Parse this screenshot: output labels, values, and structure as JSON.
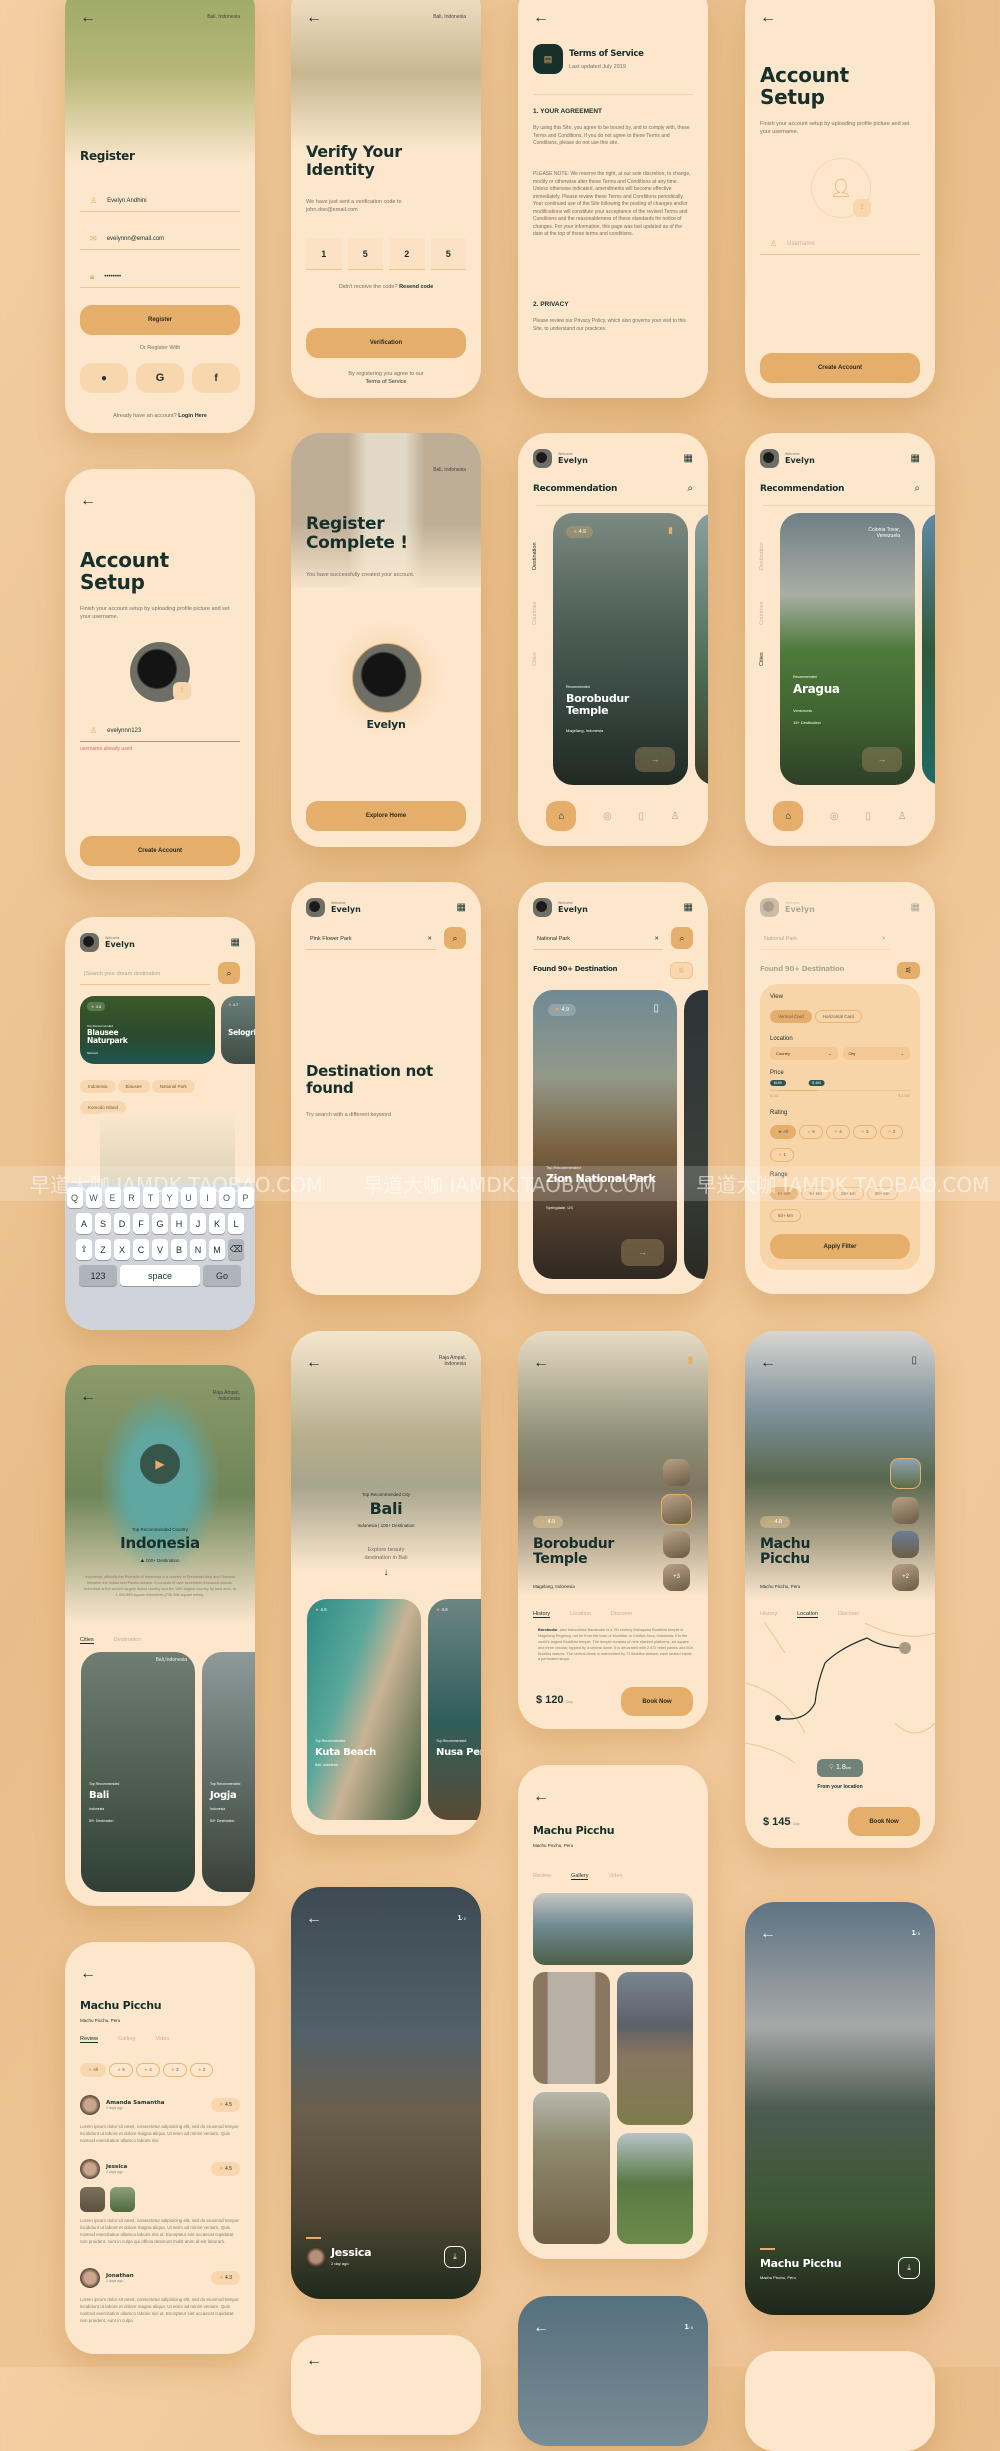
{
  "colors": {
    "background": "#eec395",
    "card": "#fce7cd",
    "accent": "#e6ae6b",
    "dark": "#17302c",
    "error": "#e06a6a"
  },
  "common": {
    "welcome": "Welcome",
    "user": "Evelyn",
    "back_icon": "arrow-left-icon",
    "recommendation": "Recommendation",
    "create_account": "Create Account",
    "book_now": "Book Now",
    "per_day": "/ Day"
  },
  "register": {
    "location": "Bali, Indonesia",
    "title": "Register",
    "name": "Evelyn Andhini",
    "email": "evelynnn@email.com",
    "password": "••••••••",
    "button": "Register",
    "or": "Or Register With",
    "social": [
      "apple",
      "google",
      "facebook"
    ],
    "footer": "Already have an account?",
    "login": "Login Here"
  },
  "verify": {
    "location": "Bali, Indonesia",
    "title": "Verify Your Identity",
    "desc": "We have just sent a verification code to john.doe@email.com",
    "code": [
      "1",
      "5",
      "2",
      "5"
    ],
    "resend_q": "Didn't receive the code?",
    "resend": "Resend code",
    "button": "Verification",
    "terms1": "By registering you agree to  our",
    "terms2": "Terms of Service"
  },
  "terms": {
    "title": "Terms of Service",
    "updated": "Last updated July 2019",
    "h1": "1. YOUR AGREEMENT",
    "p1": "By using this Site, you agree to be bound by, and to comply with, these Terms and Conditions. If you do not agree to these Terms and Conditions, please do not use this site.",
    "p2": "PLEASE NOTE: We reserve the right, at our sole discretion, to change, modify or otherwise alter these Terms and Conditions at any time. Unless otherwise indicated, amendments will become effective immediately. Please review these Terms and Conditions periodically. Your continued use of the Site following the posting of changes and/or modifications will constitute your acceptance of the revised Terms and Conditions and the reasonableness of these standards for notice of changes. For your information, this page was last updated as of the date at the top of these terms and conditions.",
    "h2": "2. PRIVACY",
    "p3": "Please review our Privacy Policy, which also governs your visit to this Site, to understand our practices."
  },
  "setup": {
    "title": "Account Setup",
    "desc": "Finish your account setup by uploading profile picture and set your username.",
    "placeholder": "Username",
    "username": "evelynnn123",
    "error": "username already used"
  },
  "complete": {
    "location": "Bali, Indonesia",
    "title": "Register Complete !",
    "desc": "You have successfully created your account.",
    "name": "Evelyn",
    "button": "Explore Home"
  },
  "reco1": {
    "tabs": [
      "Destination",
      "Countries",
      "Cities"
    ],
    "rating": "4.9",
    "label": "Recommended",
    "name": "Borobudur Temple",
    "place": "Magelang, Indonesia"
  },
  "reco2": {
    "location": "Colonia Tovar, Venezuela",
    "label": "Recommended",
    "name": "Aragua",
    "country": "Venezuela",
    "dest": "15+ Destination"
  },
  "search": {
    "placeholder": "|Search your dream destination",
    "cards": [
      {
        "rating": "4.8",
        "label": "Top Recommended",
        "name": "Blausee Naturpark",
        "place": "Schweiz"
      },
      {
        "rating": "4.7",
        "label": "Top Recommended",
        "name": "Selogriyo Temple"
      }
    ],
    "chips": [
      "Indonesia",
      "Blausee",
      "National Park",
      "Komodo Island"
    ],
    "keyboard": [
      [
        "Q",
        "W",
        "E",
        "R",
        "T",
        "Y",
        "U",
        "I",
        "O",
        "P"
      ],
      [
        "A",
        "S",
        "D",
        "F",
        "G",
        "H",
        "J",
        "K",
        "L"
      ],
      [
        "⇧",
        "Z",
        "X",
        "C",
        "V",
        "B",
        "N",
        "M",
        "⌫"
      ],
      [
        "123",
        "space",
        "Go"
      ]
    ]
  },
  "notfound": {
    "query": "Pink Flower Park",
    "title": "Destination not found",
    "desc": "Try search with a different keyword"
  },
  "results": {
    "query": "National Park",
    "found": "Found 90+ Destination",
    "rating": "4.9",
    "label": "Top Recommended",
    "name": "Zion National Park",
    "place": "Springdale, US"
  },
  "filter": {
    "view": "View",
    "view_opts": [
      "Vertical Card",
      "Horizontal Card"
    ],
    "location": "Location",
    "country": "Country",
    "city": "City",
    "price": "Price",
    "price_low": "$150",
    "price_high": "$ 400",
    "price_min": "$ 100",
    "price_max": "$ 1.000",
    "price_range": [
      150,
      400
    ],
    "price_bounds": [
      100,
      1000
    ],
    "rating": "Rating",
    "rating_opts": [
      "All",
      "5",
      "4",
      "3",
      "2",
      "1"
    ],
    "range": "Range",
    "range_opts": [
      "0+ km",
      "5+ km",
      "15+ km",
      "30+ km",
      "50+ km"
    ],
    "apply": "Apply Filter"
  },
  "indonesia": {
    "location": "Raja Ampat, Indonesia",
    "label": "Top Recommended Country",
    "name": "Indonesia",
    "dest": "100+ Destination",
    "desc": "Indonesia, officially the Republic of Indonesia is a country in Southeast Asia and Oceania between the Indian and Pacific oceans. It consists of over seventeen thousand islands. Indonesia is the world's largest island country and the 14th-largest country by land area, at 1.904.569 square kilometres (735.358 square miles).",
    "tabs": [
      "Cities",
      "Destination"
    ],
    "cards": [
      {
        "location": "Bali,Indonesia",
        "label": "Top Recommended",
        "name": "Bali",
        "country": "Indonesia",
        "dest": "80+ Destination"
      },
      {
        "label": "Top Recommended",
        "name": "Jogja",
        "country": "Indonesia",
        "dest": "50+ Destination"
      }
    ]
  },
  "bali": {
    "location": "Raja Ampat, Indonesia",
    "label": "Top Recommended City",
    "name": "Bali",
    "country": "Indonesia",
    "dest": "100+ Destination",
    "explore": "Explore beauty destination in Bali",
    "cards": [
      {
        "rating": "4.9",
        "label": "Top Recommended",
        "name": "Kuta Beach",
        "place": "Bali, Indonesia"
      },
      {
        "rating": "4.9",
        "label": "Top Recommended",
        "name": "Nusa Penida",
        "place": "Bali, Indonesia"
      }
    ]
  },
  "borobudur": {
    "rating": "4.9",
    "name": "Borobudur Temple",
    "place": "Magelang, Indonesia",
    "more": "+3",
    "tabs": [
      "History",
      "Location",
      "Discover"
    ],
    "lead": "Borobudur",
    "text": ", also transcribed Barabudur is a 7th-century Mahayana Buddhist temple in Magelang Regency, not far from the town of Muntilan, in Central Java, Indonesia. It is the world's largest Buddhist temple. The temple consists of nine stacked platforms, six square and three circular, topped by a central dome. It is decorated with 2.672 relief panels and 504 Buddha statues. The central dome is surrounded by 72 Buddha statues, each seated inside a perforated stupa.",
    "price": "$ 120"
  },
  "machu_loc": {
    "rating": "4.8",
    "name": "Machu Picchu",
    "place": "Machu Picchu, Peru",
    "more": "+2",
    "tabs": [
      "History",
      "Location",
      "Discover"
    ],
    "distance": "1.8",
    "unit": "km",
    "from": "From your location",
    "price": "$ 145"
  },
  "review": {
    "name": "Machu Picchu",
    "place": "Machu Picchu, Peru",
    "tabs": [
      "Review",
      "Gallery",
      "Video"
    ],
    "filters": [
      "All",
      "5",
      "4",
      "3",
      "2"
    ],
    "items": [
      {
        "name": "Amanda Samantha",
        "time": "2 days ago",
        "rating": "4.5",
        "text": "Lorem ipsum dolor sit amet, consectetur adipisicing elit, sed do eiusmod tempor incididunt ut labore et dolore magna aliqua. Ut enim ad minim veniam. Quis nostrud exercitation ullamco laboris nisi"
      },
      {
        "name": "Jessica",
        "time": "2 days ago",
        "rating": "4.5",
        "text": "Lorem ipsum dolor sit amet, consectetur adipisicing elit, sed do eiusmod tempor incididunt ut labore et dolore magna aliqua. Ut enim ad minim veniam. Quis nostrud exercitation ullamco laboris nisi ut. Excepteur sint occaecat cupidatat non proident, sunt in culpa qui officia deserunt mollit anim id est laborum."
      },
      {
        "name": "Jonathan",
        "time": "2 days ago",
        "rating": "4.3",
        "text": "Lorem ipsum dolor sit amet, consectetur adipisicing elit, sed do eiusmod tempor incididunt ut labore et dolore magna aliqua. Ut enim ad minim veniam. Quis nostrud exercitation ullamco laboris nisi ut. Excepteur sint occaecat cupidatat non proident, sunt in culpa"
      }
    ]
  },
  "photo_jessica": {
    "page": "1",
    "total": "/ 2",
    "name": "Jessica",
    "time": "2 day ago"
  },
  "gallery": {
    "name": "Machu Picchu",
    "place": "Machu Picchu, Peru",
    "tabs": [
      "Review",
      "Gallery",
      "Video"
    ]
  },
  "photo_machu": {
    "page": "1",
    "total": "/ 5",
    "name": "Machu Picchu",
    "place": "Machu Picchu, Peru"
  },
  "watermark": "早道大咖  IAMDK.TAOBAO.COM"
}
